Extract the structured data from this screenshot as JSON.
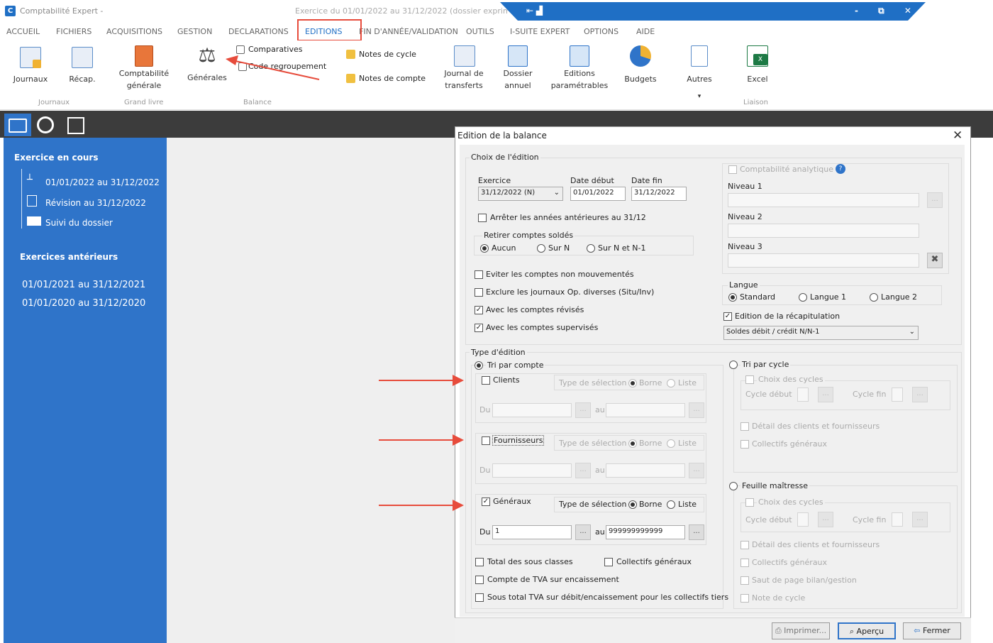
{
  "window": {
    "app_title": "Comptabilité Expert -",
    "exercise_title": "Exercice du 01/01/2022 au 31/12/2022 (dossier exprimé",
    "controls": "- ⧉ ✕"
  },
  "menu": [
    {
      "label": "ACCUEIL"
    },
    {
      "label": "FICHIERS"
    },
    {
      "label": "ACQUISITIONS"
    },
    {
      "label": "GESTION"
    },
    {
      "label": "DECLARATIONS"
    },
    {
      "label": "EDITIONS"
    },
    {
      "label": "FIN D'ANNÉE/VALIDATION"
    },
    {
      "label": "OUTILS"
    },
    {
      "label": "I-SUITE EXPERT"
    },
    {
      "label": "OPTIONS"
    },
    {
      "label": "AIDE"
    }
  ],
  "ribbon": {
    "journaux": "Journaux",
    "recap": "Récap.",
    "compta_gen_1": "Comptabilité",
    "compta_gen_2": "générale",
    "generales": "Générales",
    "comparatives": "Comparatives",
    "code_regroupement": "Code regroupement",
    "notes_cycle": "Notes de cycle",
    "notes_compte": "Notes de compte",
    "journal_transferts_1": "Journal de",
    "journal_transferts_2": "transferts",
    "dossier_annuel_1": "Dossier",
    "dossier_annuel_2": "annuel",
    "editions_param_1": "Editions",
    "editions_param_2": "paramétrables",
    "budgets": "Budgets",
    "autres": "Autres",
    "excel": "Excel",
    "group_journaux": "Journaux",
    "group_grand_livre": "Grand livre",
    "group_balance": "Balance",
    "group_liaison": "Liaison"
  },
  "sidebar": {
    "current_header": "Exercice en cours",
    "current_period": "01/01/2022 au 31/12/2022",
    "revision": "Révision au 31/12/2022",
    "suivi": "Suivi du dossier",
    "previous_header": "Exercices antérieurs",
    "prev_1": "01/01/2021 au 31/12/2021",
    "prev_2": "01/01/2020 au 31/12/2020"
  },
  "dialog": {
    "title": "Edition de la balance",
    "choix_edition": "Choix de l'édition",
    "exercice_label": "Exercice",
    "exercice_value": "31/12/2022 (N)",
    "date_debut_label": "Date début",
    "date_debut_value": "01/01/2022",
    "date_fin_label": "Date fin",
    "date_fin_value": "31/12/2022",
    "arreter": "Arrêter les années antérieures au 31/12",
    "retirer_label": "Retirer comptes soldés",
    "aucun": "Aucun",
    "sur_n": "Sur N",
    "sur_n_n1": "Sur N et N-1",
    "eviter": "Eviter les comptes non mouvementés",
    "exclure": "Exclure les journaux Op. diverses (Situ/Inv)",
    "avec_revises": "Avec les comptes révisés",
    "avec_supervises": "Avec les comptes supervisés",
    "analytique": "Comptabilité analytique",
    "niveau1": "Niveau 1",
    "niveau2": "Niveau 2",
    "niveau3": "Niveau 3",
    "langue_label": "Langue",
    "standard": "Standard",
    "langue1": "Langue 1",
    "langue2": "Langue 2",
    "recap": "Edition de la récapitulation",
    "soldes_value": "Soldes débit / crédit N/N-1",
    "type_edition": "Type d'édition",
    "tri_compte": "Tri par compte",
    "clients": "Clients",
    "fournisseurs": "Fournisseurs",
    "generaux": "Généraux",
    "type_selection": "Type de sélection",
    "borne": "Borne",
    "liste": "Liste",
    "du": "Du",
    "au": "au",
    "du_value": "1",
    "au_value": "999999999999",
    "ellipsis": "...",
    "total_sous_classes": "Total des sous classes",
    "collectifs_generaux": "Collectifs généraux",
    "compte_tva": "Compte de TVA sur encaissement",
    "sous_total_tva": "Sous total TVA sur débit/encaissement pour les collectifs tiers",
    "tri_cycle": "Tri par cycle",
    "choix_cycles": "Choix des cycles",
    "cycle_debut": "Cycle début",
    "cycle_fin": "Cycle fin",
    "detail_clients": "Détail des clients et fournisseurs",
    "feuille_maitresse": "Feuille maîtresse",
    "saut_page": "Saut de page bilan/gestion",
    "note_cycle": "Note de cycle",
    "imprimer": "Imprimer...",
    "apercu": "Aperçu",
    "fermer": "Fermer",
    "close_glyph": "✕",
    "check_glyph": "✓"
  }
}
